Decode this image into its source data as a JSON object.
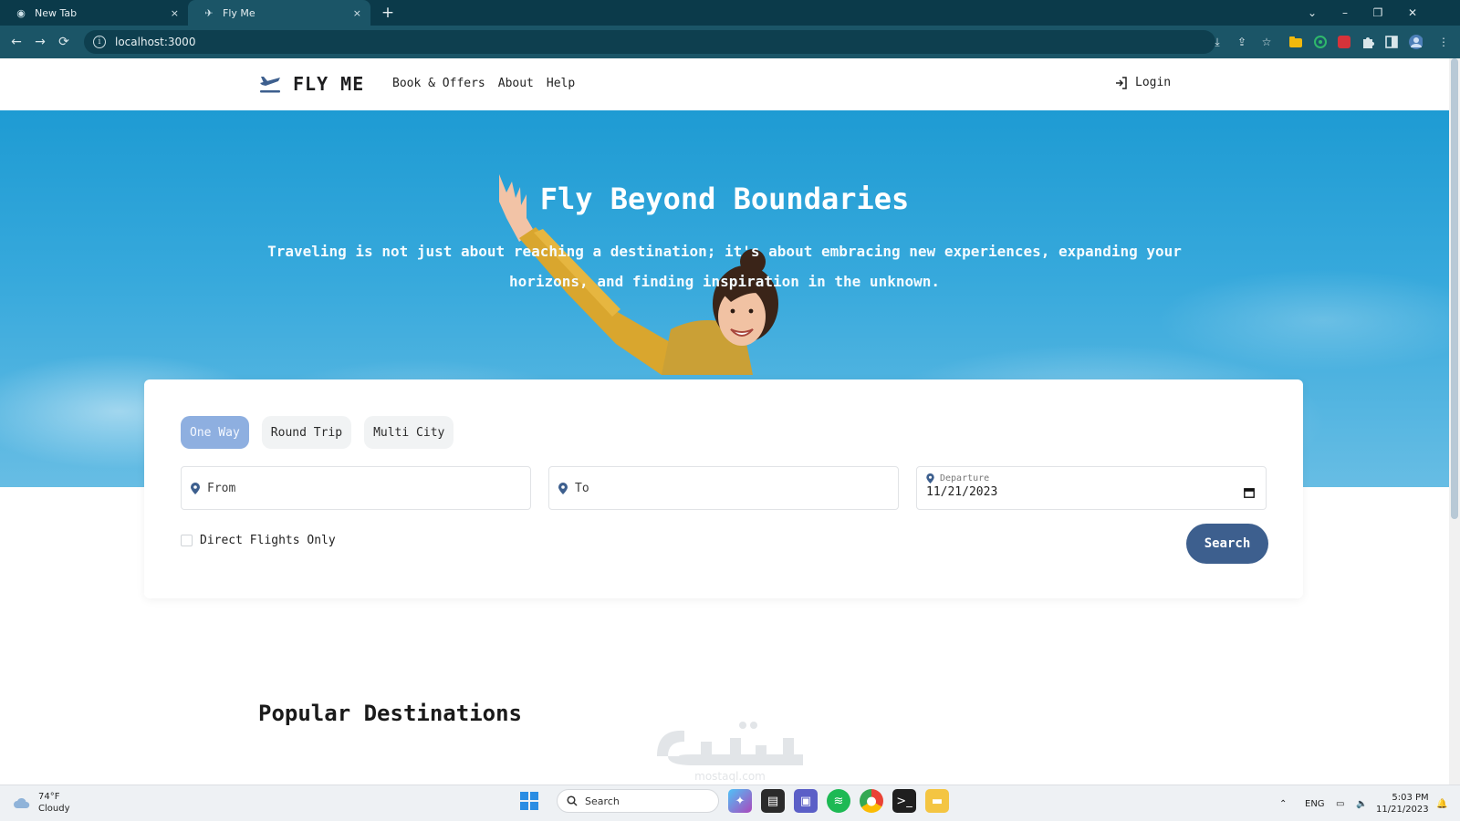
{
  "browser": {
    "tabs": [
      {
        "title": "New Tab",
        "close": "×"
      },
      {
        "title": "Fly Me",
        "close": "×"
      }
    ],
    "new_tab": "+",
    "url": "localhost:3000",
    "window_controls": {
      "tab_search": "⌄",
      "minimize": "–",
      "restore": "❐",
      "close": "✕"
    },
    "nav": {
      "back": "←",
      "forward": "→",
      "reload": "⟳"
    },
    "extension_icons": [
      "install-icon",
      "share-icon",
      "star-icon",
      "folder-extension-icon",
      "green-circle-extension-icon",
      "red-extension-icon",
      "puzzle-icon",
      "side-panel-icon",
      "profile-avatar-icon",
      "menu-icon"
    ]
  },
  "site": {
    "brand": "FLY ME",
    "nav": [
      "Book & Offers",
      "About",
      "Help"
    ],
    "login": "Login"
  },
  "hero": {
    "title": "Fly Beyond Boundaries",
    "subtitle": "Traveling is not just about reaching a destination; it's about embracing new experiences, expanding your horizons, and finding inspiration in the unknown."
  },
  "search": {
    "trip_types": [
      "One Way",
      "Round Trip",
      "Multi City"
    ],
    "selected_trip": "One Way",
    "from_placeholder": "From",
    "to_placeholder": "To",
    "departure_label": "Departure",
    "departure_value": "11/21/2023",
    "direct_only_label": "Direct Flights Only",
    "direct_only_checked": false,
    "search_button": "Search"
  },
  "sections": {
    "popular_title": "Popular Destinations"
  },
  "taskbar": {
    "weather_temp": "74°F",
    "weather_desc": "Cloudy",
    "search_label": "Search",
    "language": "ENG",
    "time": "5:03 PM",
    "date": "11/21/2023"
  },
  "colors": {
    "accent": "#3d5f8e",
    "selected_tab": "#8eafe0",
    "hero_sky": "#1e9bd3",
    "chrome_dark": "#0b3a4a"
  }
}
